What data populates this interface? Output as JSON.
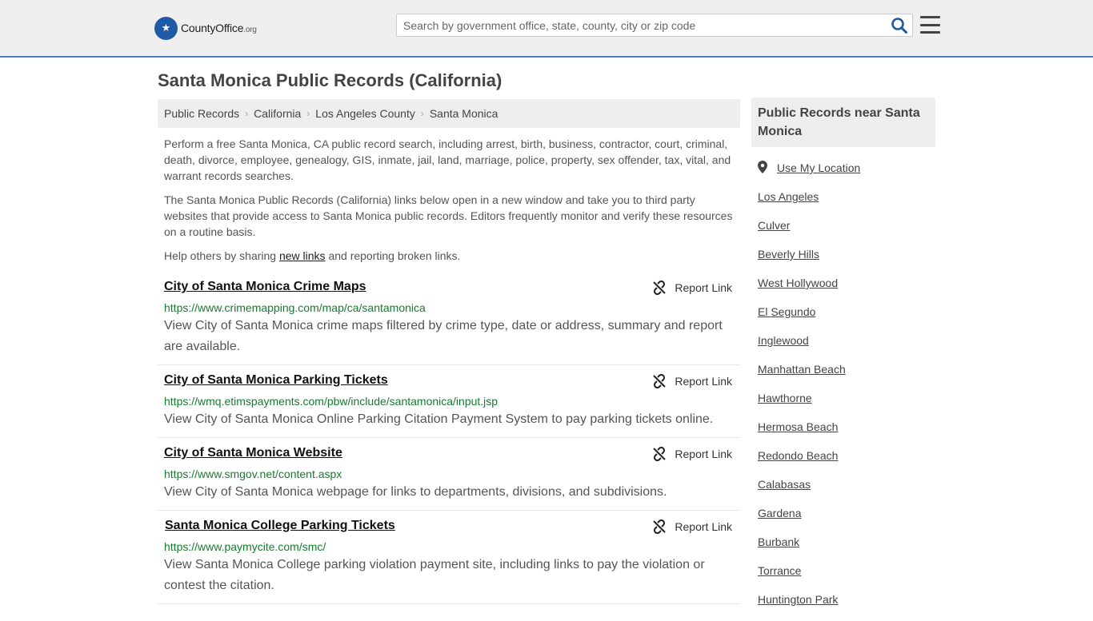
{
  "header": {
    "logo_name": "County",
    "logo_accent": "Office",
    "logo_tld": ".org",
    "search_placeholder": "Search by government office, state, county, city or zip code"
  },
  "page_title": "Santa Monica Public Records (California)",
  "breadcrumb": [
    "Public Records",
    "California",
    "Los Angeles County",
    "Santa Monica"
  ],
  "intro": {
    "p1": "Perform a free Santa Monica, CA public record search, including arrest, birth, business, contractor, court, criminal, death, divorce, employee, genealogy, GIS, inmate, jail, land, marriage, police, property, sex offender, tax, vital, and warrant records searches.",
    "p2": "The Santa Monica Public Records (California) links below open in a new window and take you to third party websites that provide access to Santa Monica public records. Editors frequently monitor and verify these resources on a routine basis.",
    "p3_before": "Help others by sharing ",
    "p3_link": "new links",
    "p3_after": " and reporting broken links."
  },
  "report_label": "Report Link",
  "entries": [
    {
      "title": "City of Santa Monica Crime Maps",
      "url": "https://www.crimemapping.com/map/ca/santamonica",
      "desc": "View City of Santa Monica crime maps filtered by crime type, date or address, summary and report are available."
    },
    {
      "title": "City of Santa Monica Parking Tickets",
      "url": "https://wmq.etimspayments.com/pbw/include/santamonica/input.jsp",
      "desc": "View City of Santa Monica Online Parking Citation Payment System to pay parking tickets online."
    },
    {
      "title": "City of Santa Monica Website",
      "url": "https://www.smgov.net/content.aspx",
      "desc": "View City of Santa Monica webpage for links to departments, divisions, and subdivisions."
    },
    {
      "title": "Santa Monica College Parking Tickets",
      "url": "https://www.paymycite.com/smc/",
      "desc": "View Santa Monica College parking violation payment site, including links to pay the violation or contest the citation."
    }
  ],
  "sidebar": {
    "heading": "Public Records near Santa Monica",
    "use_location": "Use My Location",
    "places": [
      "Los Angeles",
      "Culver",
      "Beverly Hills",
      "West Hollywood",
      "El Segundo",
      "Inglewood",
      "Manhattan Beach",
      "Hawthorne",
      "Hermosa Beach",
      "Redondo Beach",
      "Calabasas",
      "Gardena",
      "Burbank",
      "Torrance",
      "Huntington Park"
    ]
  },
  "colors": {
    "brand_blue": "#1f5aa6",
    "url_green": "#187a2f",
    "header_border": "#4e7cba"
  },
  "icons": [
    "county-seal-icon",
    "search-icon",
    "hamburger-menu-icon",
    "broken-link-icon",
    "map-pin-icon"
  ]
}
